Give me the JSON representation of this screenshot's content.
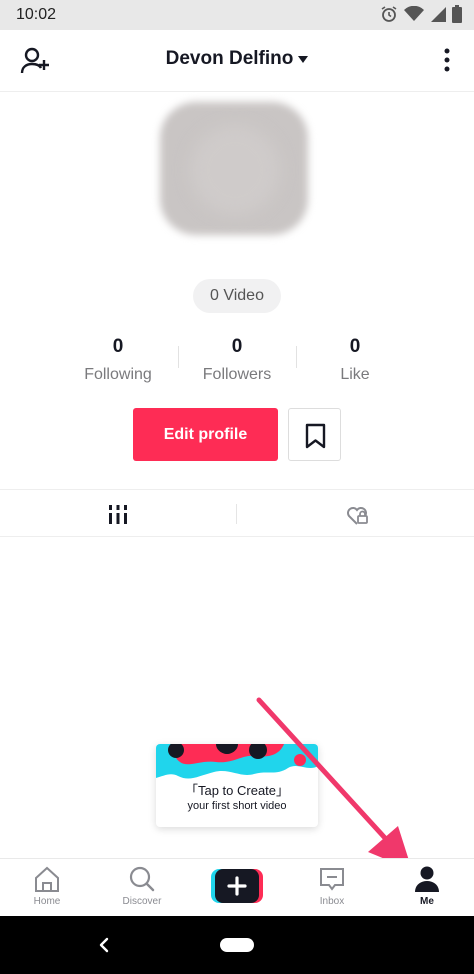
{
  "status_bar": {
    "time": "10:02",
    "icons": [
      "alarm-icon",
      "wifi-icon",
      "signal-icon",
      "battery-icon"
    ]
  },
  "header": {
    "username": "Devon Delfino",
    "left_icon": "add-user-icon",
    "right_icon": "more-options-icon"
  },
  "profile": {
    "video_count": "0 Video",
    "stats": [
      {
        "value": "0",
        "label": "Following"
      },
      {
        "value": "0",
        "label": "Followers"
      },
      {
        "value": "0",
        "label": "Like"
      }
    ],
    "edit_button": "Edit profile",
    "bookmark_icon": "bookmark-icon"
  },
  "tabs": [
    {
      "icon": "grid-icon",
      "name": "videos"
    },
    {
      "icon": "liked-private-icon",
      "name": "liked"
    }
  ],
  "tooltip": {
    "title": "「Tap to Create」",
    "subtitle": "your first short video"
  },
  "nav": [
    {
      "label": "Home",
      "icon": "home-icon",
      "active": false
    },
    {
      "label": "Discover",
      "icon": "search-icon",
      "active": false
    },
    {
      "label": "",
      "icon": "create-plus-icon",
      "active": false
    },
    {
      "label": "Inbox",
      "icon": "inbox-icon",
      "active": false
    },
    {
      "label": "Me",
      "icon": "person-icon",
      "active": true
    }
  ],
  "colors": {
    "accent": "#fe2c55",
    "annotation_arrow": "#f0386b",
    "cyan": "#20d5ec",
    "dark": "#161823"
  }
}
